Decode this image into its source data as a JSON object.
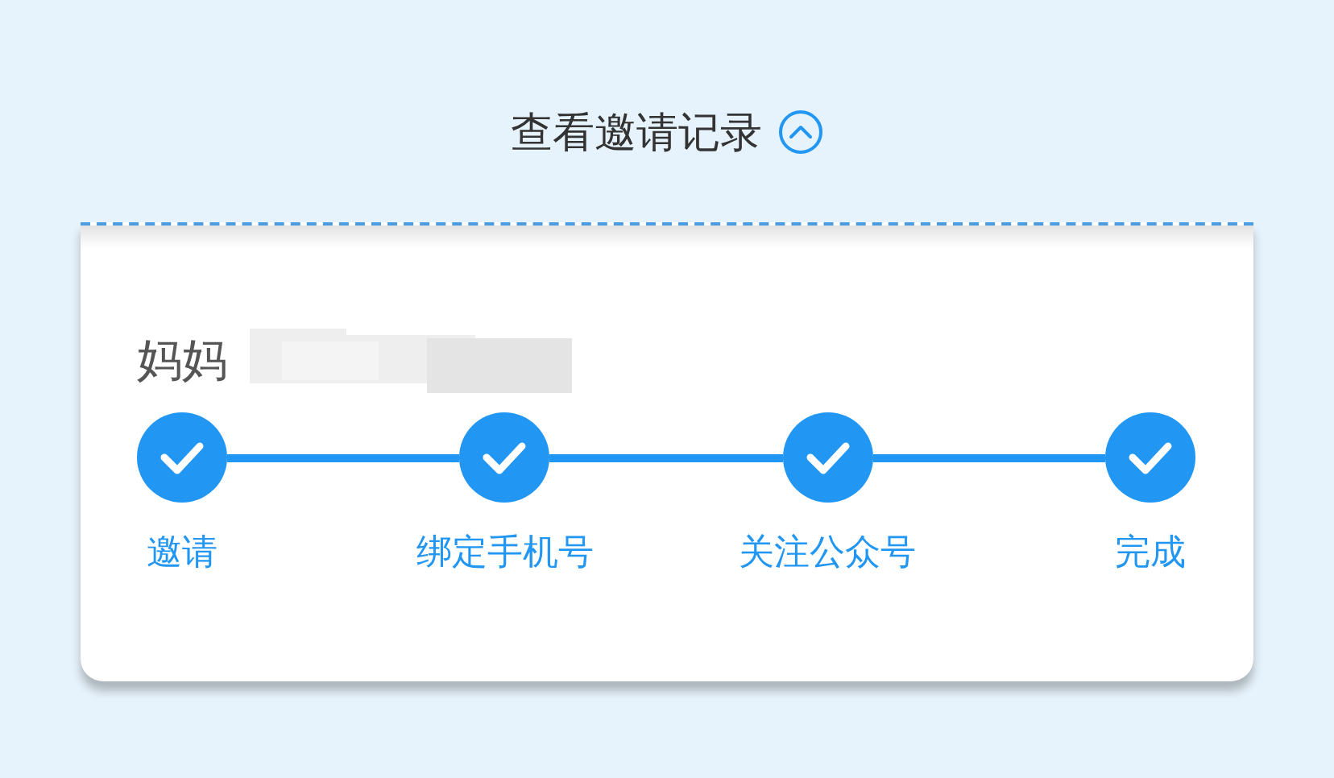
{
  "header": {
    "title": "查看邀请记录",
    "expanded": true
  },
  "record": {
    "name": "妈妈",
    "steps": [
      {
        "label": "邀请",
        "done": true
      },
      {
        "label": "绑定手机号",
        "done": true
      },
      {
        "label": "关注公众号",
        "done": true
      },
      {
        "label": "完成",
        "done": true
      }
    ]
  }
}
